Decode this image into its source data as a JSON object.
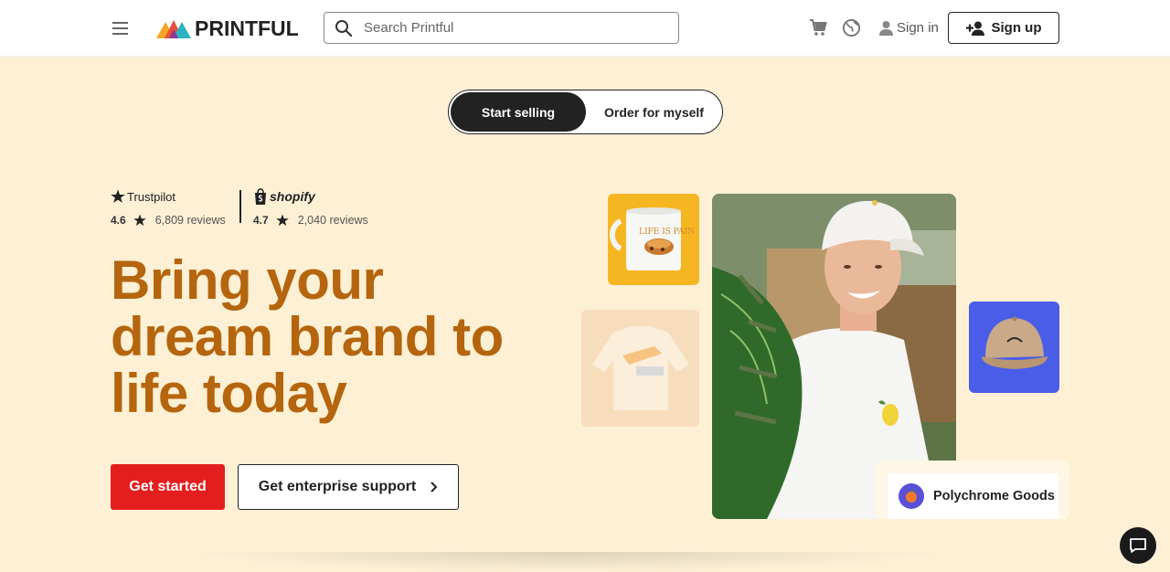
{
  "header": {
    "logo_text": "PRINTFUL",
    "search_placeholder": "Search Printful",
    "signin_label": "Sign in",
    "signup_label": "Sign up"
  },
  "toggle": {
    "active_label": "Start selling",
    "other_label": "Order for myself"
  },
  "ratings": {
    "trustpilot": {
      "name": "Trustpilot",
      "score": "4.6",
      "reviews": "6,809 reviews"
    },
    "shopify": {
      "name": "shopify",
      "score": "4.7",
      "reviews": "2,040 reviews"
    }
  },
  "hero": {
    "headline_line1": "Bring your",
    "headline_line2": "dream brand to",
    "headline_line3": "life today",
    "primary_cta": "Get started",
    "secondary_cta": "Get enterprise support",
    "mug_text": "LIFE IS PAIN",
    "brand_name": "Polychrome Goods"
  },
  "colors": {
    "background": "#fdf0d5",
    "headline": "#b5650d",
    "primary": "#e41e1e",
    "mug_card": "#f6b622",
    "hat_card": "#4a5de8"
  }
}
